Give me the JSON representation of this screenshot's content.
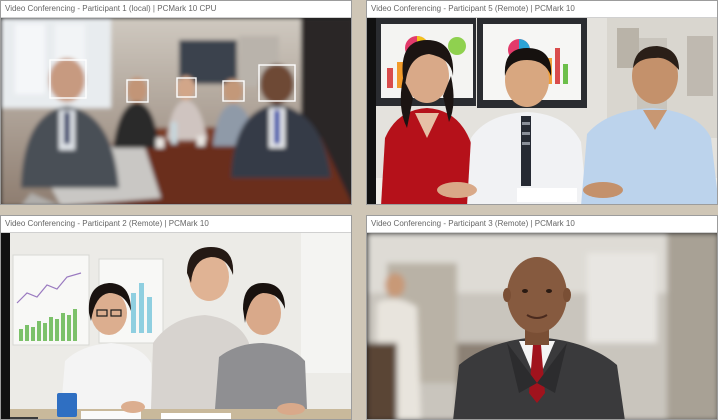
{
  "windows": [
    {
      "id": "p1",
      "title": "Video Conferencing - Participant 1 (local) | PCMark 10 CPU"
    },
    {
      "id": "p5",
      "title": "Video Conferencing - Participant 5 (Remote) | PCMark 10"
    },
    {
      "id": "p2",
      "title": "Video Conferencing - Participant 2 (Remote) | PCMark 10"
    },
    {
      "id": "p3",
      "title": "Video Conferencing - Participant 3 (Remote) | PCMark 10"
    }
  ],
  "colors": {
    "titlebar_bg": "#ffffff",
    "titlebar_text": "#666666",
    "face_box": "#ffffff"
  }
}
